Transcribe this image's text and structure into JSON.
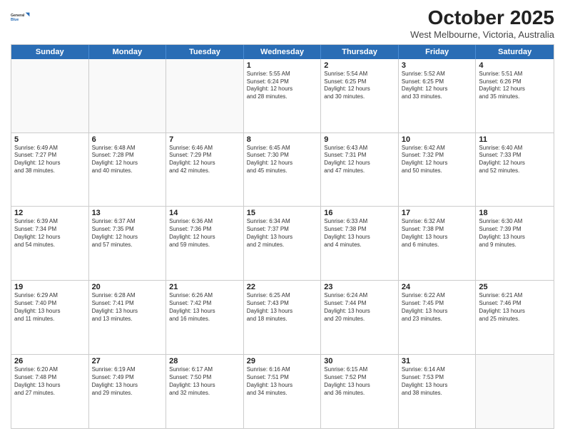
{
  "logo": {
    "line1": "General",
    "line2": "Blue"
  },
  "title": "October 2025",
  "subtitle": "West Melbourne, Victoria, Australia",
  "header_days": [
    "Sunday",
    "Monday",
    "Tuesday",
    "Wednesday",
    "Thursday",
    "Friday",
    "Saturday"
  ],
  "weeks": [
    [
      {
        "day": "",
        "info": "",
        "empty": true
      },
      {
        "day": "",
        "info": "",
        "empty": true
      },
      {
        "day": "",
        "info": "",
        "empty": true
      },
      {
        "day": "1",
        "info": "Sunrise: 5:55 AM\nSunset: 6:24 PM\nDaylight: 12 hours\nand 28 minutes.",
        "empty": false
      },
      {
        "day": "2",
        "info": "Sunrise: 5:54 AM\nSunset: 6:25 PM\nDaylight: 12 hours\nand 30 minutes.",
        "empty": false
      },
      {
        "day": "3",
        "info": "Sunrise: 5:52 AM\nSunset: 6:25 PM\nDaylight: 12 hours\nand 33 minutes.",
        "empty": false
      },
      {
        "day": "4",
        "info": "Sunrise: 5:51 AM\nSunset: 6:26 PM\nDaylight: 12 hours\nand 35 minutes.",
        "empty": false
      }
    ],
    [
      {
        "day": "5",
        "info": "Sunrise: 6:49 AM\nSunset: 7:27 PM\nDaylight: 12 hours\nand 38 minutes.",
        "empty": false
      },
      {
        "day": "6",
        "info": "Sunrise: 6:48 AM\nSunset: 7:28 PM\nDaylight: 12 hours\nand 40 minutes.",
        "empty": false
      },
      {
        "day": "7",
        "info": "Sunrise: 6:46 AM\nSunset: 7:29 PM\nDaylight: 12 hours\nand 42 minutes.",
        "empty": false
      },
      {
        "day": "8",
        "info": "Sunrise: 6:45 AM\nSunset: 7:30 PM\nDaylight: 12 hours\nand 45 minutes.",
        "empty": false
      },
      {
        "day": "9",
        "info": "Sunrise: 6:43 AM\nSunset: 7:31 PM\nDaylight: 12 hours\nand 47 minutes.",
        "empty": false
      },
      {
        "day": "10",
        "info": "Sunrise: 6:42 AM\nSunset: 7:32 PM\nDaylight: 12 hours\nand 50 minutes.",
        "empty": false
      },
      {
        "day": "11",
        "info": "Sunrise: 6:40 AM\nSunset: 7:33 PM\nDaylight: 12 hours\nand 52 minutes.",
        "empty": false
      }
    ],
    [
      {
        "day": "12",
        "info": "Sunrise: 6:39 AM\nSunset: 7:34 PM\nDaylight: 12 hours\nand 54 minutes.",
        "empty": false
      },
      {
        "day": "13",
        "info": "Sunrise: 6:37 AM\nSunset: 7:35 PM\nDaylight: 12 hours\nand 57 minutes.",
        "empty": false
      },
      {
        "day": "14",
        "info": "Sunrise: 6:36 AM\nSunset: 7:36 PM\nDaylight: 12 hours\nand 59 minutes.",
        "empty": false
      },
      {
        "day": "15",
        "info": "Sunrise: 6:34 AM\nSunset: 7:37 PM\nDaylight: 13 hours\nand 2 minutes.",
        "empty": false
      },
      {
        "day": "16",
        "info": "Sunrise: 6:33 AM\nSunset: 7:38 PM\nDaylight: 13 hours\nand 4 minutes.",
        "empty": false
      },
      {
        "day": "17",
        "info": "Sunrise: 6:32 AM\nSunset: 7:38 PM\nDaylight: 13 hours\nand 6 minutes.",
        "empty": false
      },
      {
        "day": "18",
        "info": "Sunrise: 6:30 AM\nSunset: 7:39 PM\nDaylight: 13 hours\nand 9 minutes.",
        "empty": false
      }
    ],
    [
      {
        "day": "19",
        "info": "Sunrise: 6:29 AM\nSunset: 7:40 PM\nDaylight: 13 hours\nand 11 minutes.",
        "empty": false
      },
      {
        "day": "20",
        "info": "Sunrise: 6:28 AM\nSunset: 7:41 PM\nDaylight: 13 hours\nand 13 minutes.",
        "empty": false
      },
      {
        "day": "21",
        "info": "Sunrise: 6:26 AM\nSunset: 7:42 PM\nDaylight: 13 hours\nand 16 minutes.",
        "empty": false
      },
      {
        "day": "22",
        "info": "Sunrise: 6:25 AM\nSunset: 7:43 PM\nDaylight: 13 hours\nand 18 minutes.",
        "empty": false
      },
      {
        "day": "23",
        "info": "Sunrise: 6:24 AM\nSunset: 7:44 PM\nDaylight: 13 hours\nand 20 minutes.",
        "empty": false
      },
      {
        "day": "24",
        "info": "Sunrise: 6:22 AM\nSunset: 7:45 PM\nDaylight: 13 hours\nand 23 minutes.",
        "empty": false
      },
      {
        "day": "25",
        "info": "Sunrise: 6:21 AM\nSunset: 7:46 PM\nDaylight: 13 hours\nand 25 minutes.",
        "empty": false
      }
    ],
    [
      {
        "day": "26",
        "info": "Sunrise: 6:20 AM\nSunset: 7:48 PM\nDaylight: 13 hours\nand 27 minutes.",
        "empty": false
      },
      {
        "day": "27",
        "info": "Sunrise: 6:19 AM\nSunset: 7:49 PM\nDaylight: 13 hours\nand 29 minutes.",
        "empty": false
      },
      {
        "day": "28",
        "info": "Sunrise: 6:17 AM\nSunset: 7:50 PM\nDaylight: 13 hours\nand 32 minutes.",
        "empty": false
      },
      {
        "day": "29",
        "info": "Sunrise: 6:16 AM\nSunset: 7:51 PM\nDaylight: 13 hours\nand 34 minutes.",
        "empty": false
      },
      {
        "day": "30",
        "info": "Sunrise: 6:15 AM\nSunset: 7:52 PM\nDaylight: 13 hours\nand 36 minutes.",
        "empty": false
      },
      {
        "day": "31",
        "info": "Sunrise: 6:14 AM\nSunset: 7:53 PM\nDaylight: 13 hours\nand 38 minutes.",
        "empty": false
      },
      {
        "day": "",
        "info": "",
        "empty": true
      }
    ]
  ]
}
